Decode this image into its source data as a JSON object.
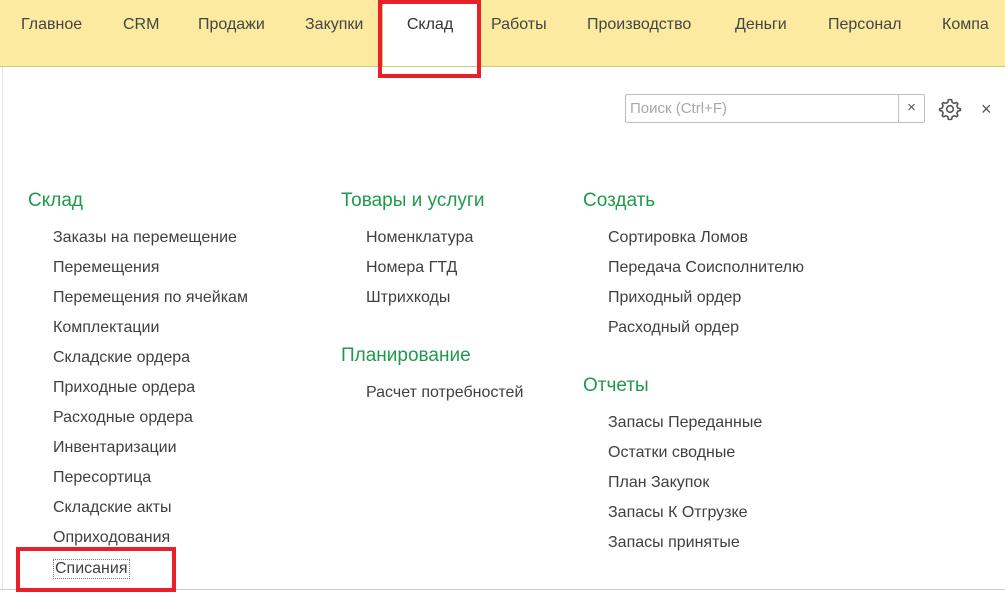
{
  "top_tabs": [
    {
      "label": "Главное"
    },
    {
      "label": "CRM"
    },
    {
      "label": "Продажи"
    },
    {
      "label": "Закупки"
    },
    {
      "label": "Склад"
    },
    {
      "label": "Работы"
    },
    {
      "label": "Производство"
    },
    {
      "label": "Деньги"
    },
    {
      "label": "Персонал"
    },
    {
      "label": "Компа"
    }
  ],
  "active_tab": "Склад",
  "search": {
    "placeholder": "Поиск (Ctrl+F)",
    "value": "",
    "clear_glyph": "×"
  },
  "icons": {
    "settings": "gear-icon",
    "close": "close-icon"
  },
  "close_glyph": "×",
  "columns": {
    "sklad": {
      "title": "Склад",
      "items": [
        "Заказы на перемещение",
        "Перемещения",
        "Перемещения по ячейкам",
        "Комплектации",
        "Складские ордера",
        "Приходные ордера",
        "Расходные ордера",
        "Инвентаризации",
        "Пересортица",
        "Складские акты",
        "Оприходования",
        "Списания"
      ]
    },
    "goods": {
      "title": "Товары и услуги",
      "items": [
        "Номенклатура",
        "Номера ГТД",
        "Штрихкоды"
      ]
    },
    "planning": {
      "title": "Планирование",
      "items": [
        "Расчет потребностей"
      ]
    },
    "create": {
      "title": "Создать",
      "items": [
        "Сортировка Ломов",
        "Передача Соисполнителю",
        "Приходный ордер",
        "Расходный ордер"
      ]
    },
    "reports": {
      "title": "Отчеты",
      "items": [
        "Запасы Переданные",
        "Остатки сводные",
        "План Закупок",
        "Запасы К Отгрузке",
        "Запасы принятые"
      ]
    }
  },
  "colors": {
    "tabbar_bg": "#fbeaa0",
    "section_title": "#1f9a4c",
    "highlight": "#e8202a"
  }
}
